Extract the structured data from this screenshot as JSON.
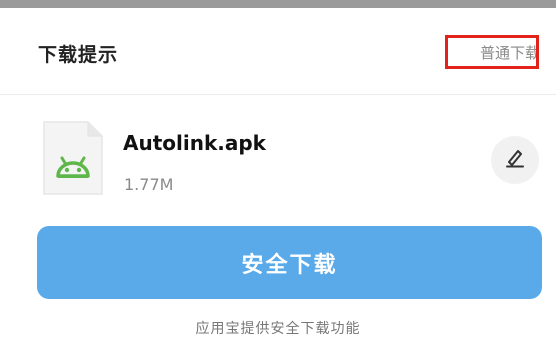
{
  "dialog": {
    "title": "下载提示",
    "normal_download_label": "普通下载"
  },
  "file": {
    "name": "Autolink.apk",
    "size": "1.77M",
    "icon": "android-file-icon"
  },
  "actions": {
    "edit_icon": "pencil-icon",
    "safe_download_label": "安全下载"
  },
  "footer": {
    "note": "应用宝提供安全下载功能"
  },
  "colors": {
    "primary_button": "#5aaae9",
    "highlight_box": "#e2221b",
    "android_green": "#5fb64b"
  }
}
